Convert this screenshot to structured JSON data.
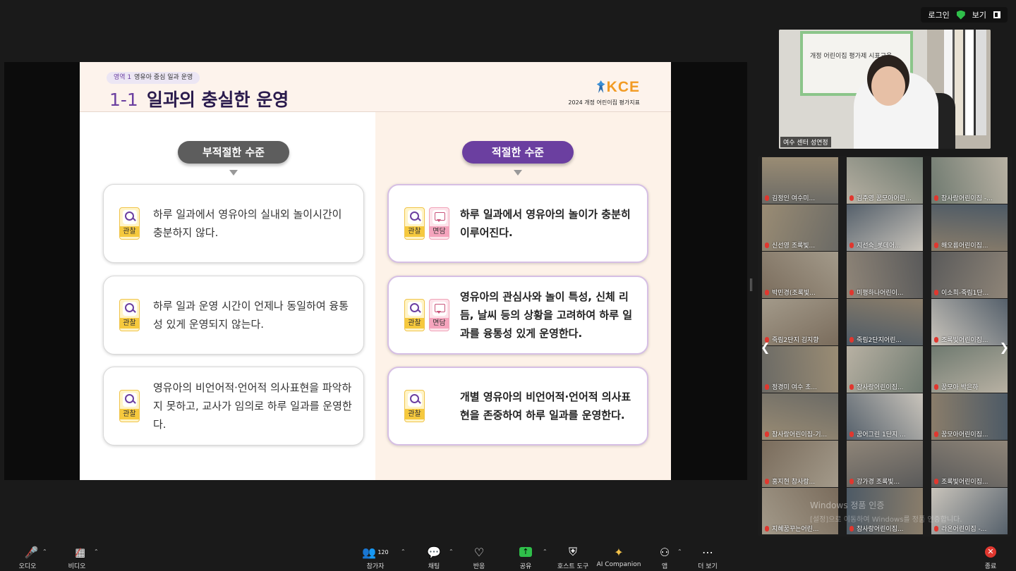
{
  "topbar": {
    "login": "로그인",
    "view": "보기"
  },
  "slide": {
    "area_label": "영역 1",
    "area_text": "영유아 중심 일과 운영",
    "title_num": "1-1",
    "title": "일과의 충실한 운영",
    "logo_text": "KCE",
    "logo_sub": "2024 개정 어린이집 평가지표",
    "bad_level": "부적절한 수준",
    "good_level": "적절한 수준",
    "badge_obs": "관찰",
    "badge_interview": "면담",
    "bad_cards": [
      {
        "text": "하루 일과에서 영유아의 실내외 놀이시간이 충분하지 않다."
      },
      {
        "text": "하루 일과 운영 시간이 언제나 동일하여 융통성 있게 운영되지 않는다."
      },
      {
        "text": "영유아의 비언어적·언어적 의사표현을 파악하지 못하고, 교사가 임의로 하루 일과를 운영한다."
      }
    ],
    "good_cards": [
      {
        "text": "하루 일과에서 영유아의 놀이가 충분히 이루어진다."
      },
      {
        "text": "영유아의 관심사와 놀이 특성, 신체 리듬, 날씨 등의 상황을 고려하여 하루 일과를 융통성 있게 운영한다."
      },
      {
        "text": "개별 영유아의 비언어적·언어적 의사표현을 존중하여 하루 일과를 운영한다."
      }
    ]
  },
  "self_video": {
    "name": "여수 센터 성연정",
    "board_text": "개정 어린이집 평가제 시표교육"
  },
  "gallery": {
    "participants": [
      "김정인 여수미...",
      "김주영 꿈모아어린...",
      "참사랑어린이집 -...",
      "신선영 조록빛...",
      "지선숙_롯데어...",
      "해오름어린이집...",
      "박민경(조록빛...",
      "미평하나어린이...",
      "이소희-죽림1단...",
      "죽림2단지 김지향",
      "죽림2단지어린...",
      "조록빛어린이집...",
      "정경미 여수 초...",
      "참사랑어린이집...",
      "꿈모아 박은하",
      "참사랑어린이집-기...",
      "꿈어그린 1단지 ...",
      "꿈모아어린이집...",
      "홍지현  참사랑...",
      "강가경 조록빛...",
      "조록빛어린이집...",
      "지혜꿈꾸는어린...",
      "참사랑어린이집...",
      "라온어린이집 -..."
    ]
  },
  "watermark": {
    "line1": "Windows 정품 인증",
    "line2": "[설정]으로 이동하여 Windows를 정품 인증합니다."
  },
  "toolbar": {
    "audio": "오디오",
    "video": "비디오",
    "participants": "참가자",
    "participants_count": "120",
    "chat": "채팅",
    "reactions": "반응",
    "share": "공유",
    "host_tools": "호스트 도구",
    "ai_companion": "AI Companion",
    "apps": "앱",
    "more": "더 보기",
    "end": "종료"
  },
  "colors": {
    "accent_purple": "#6b3fa0",
    "share_green": "#2fbf4a",
    "end_red": "#e0372f"
  }
}
